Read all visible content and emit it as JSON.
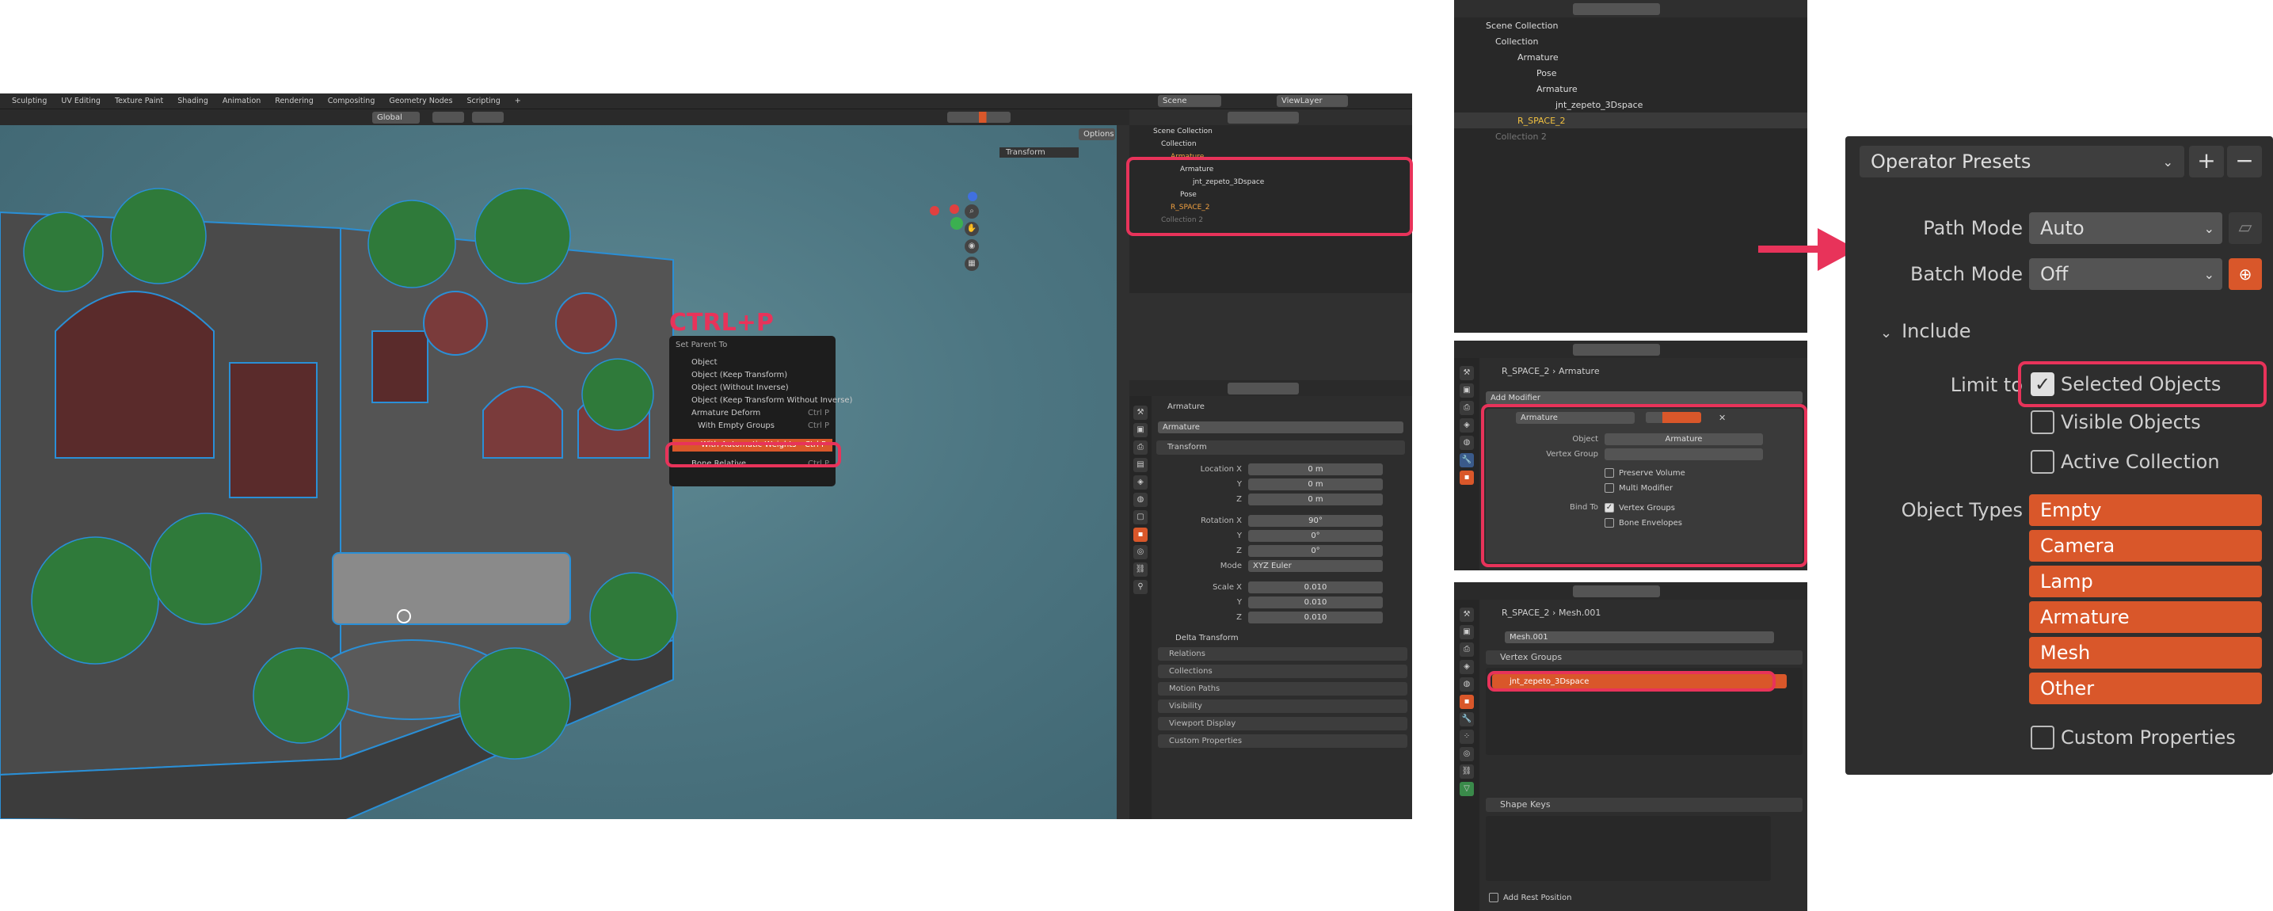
{
  "workspace_tabs": [
    "Sculpting",
    "UV Editing",
    "Texture Paint",
    "Shading",
    "Animation",
    "Rendering",
    "Compositing",
    "Geometry Nodes",
    "Scripting"
  ],
  "viewport": {
    "orientation": "Global",
    "options_label": "Options",
    "transform_label": "Transform",
    "shortcut_overlay": "CTRL+P"
  },
  "context_menu": {
    "title": "Set Parent To",
    "items": [
      {
        "label": "Object",
        "shortcut": ""
      },
      {
        "label": "Object (Keep Transform)",
        "shortcut": ""
      },
      {
        "label": "Object (Without Inverse)",
        "shortcut": ""
      },
      {
        "label": "Object (Keep Transform Without Inverse)",
        "shortcut": ""
      },
      {
        "label": "Armature Deform",
        "shortcut": "Ctrl P"
      },
      {
        "label": "With Empty Groups",
        "shortcut": "Ctrl P"
      },
      {
        "label": "With Automatic Weights",
        "shortcut": "Ctrl P"
      },
      {
        "label": "Bone Relative",
        "shortcut": "Ctrl P"
      }
    ]
  },
  "top_header": {
    "scene": "Scene",
    "view_layer": "ViewLayer"
  },
  "outliner_small": {
    "rows": [
      "Scene Collection",
      "Collection",
      "Armature",
      "Armature",
      "jnt_zepeto_3Dspace",
      "Pose",
      "R_SPACE_2",
      "Collection 2"
    ]
  },
  "props_small": {
    "object": "Armature",
    "name_field": "Armature",
    "panel": "Transform",
    "location": {
      "label": "Location X",
      "x": "0 m",
      "y": "0 m",
      "z": "0 m"
    },
    "rotation": {
      "label": "Rotation X",
      "x": "90°",
      "y": "0°",
      "z": "0°"
    },
    "mode_label": "Mode",
    "mode": "XYZ Euler",
    "scale": {
      "label": "Scale X",
      "x": "0.010",
      "y": "0.010",
      "z": "0.010"
    },
    "axis_y": "Y",
    "axis_z": "Z",
    "delta": "Delta Transform",
    "collapsed": [
      "Relations",
      "Collections",
      "Motion Paths",
      "Visibility",
      "Viewport Display",
      "Custom Properties"
    ]
  },
  "outliner_large": {
    "rows": [
      "Scene Collection",
      "Collection",
      "Armature",
      "Pose",
      "Armature",
      "jnt_zepeto_3Dspace",
      "R_SPACE_2",
      "Collection 2"
    ]
  },
  "modifier_panel": {
    "breadcrumb_obj": "R_SPACE_2",
    "breadcrumb_sep": "›",
    "breadcrumb_item": "Armature",
    "add_modifier": "Add Modifier",
    "modifier_name": "Armature",
    "object_label": "Object",
    "object_value": "Armature",
    "vertex_group_label": "Vertex Group",
    "preserve_volume": "Preserve Volume",
    "multi_modifier": "Multi Modifier",
    "bind_to_label": "Bind To",
    "vertex_groups": "Vertex Groups",
    "bone_envelopes": "Bone Envelopes"
  },
  "data_panel": {
    "breadcrumb_obj": "R_SPACE_2",
    "breadcrumb_sep": "›",
    "breadcrumb_item": "Mesh.001",
    "mesh_name": "Mesh.001",
    "vertex_groups_header": "Vertex Groups",
    "vertex_group_item": "jnt_zepeto_3Dspace",
    "shape_keys_header": "Shape Keys",
    "add_rest_position": "Add Rest Position"
  },
  "export_panel": {
    "operator_presets": "Operator Presets",
    "path_mode_label": "Path Mode",
    "path_mode": "Auto",
    "batch_mode_label": "Batch Mode",
    "batch_mode": "Off",
    "include_header": "Include",
    "limit_to_label": "Limit to",
    "selected_objects": "Selected Objects",
    "visible_objects": "Visible Objects",
    "active_collection": "Active Collection",
    "object_types_label": "Object Types",
    "object_types": [
      "Empty",
      "Camera",
      "Lamp",
      "Armature",
      "Mesh",
      "Other"
    ],
    "custom_properties": "Custom Properties"
  },
  "colors": {
    "highlight": "#e8335a",
    "orange": "#d9572a",
    "panel_bg": "#303030"
  }
}
